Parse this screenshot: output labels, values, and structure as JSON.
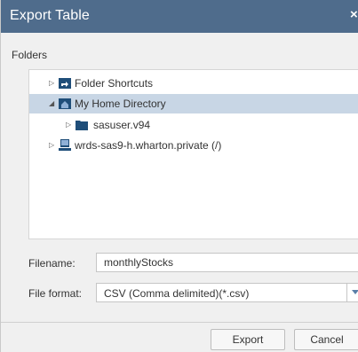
{
  "dialog": {
    "title": "Export Table",
    "close_glyph": "×"
  },
  "folders": {
    "label": "Folders",
    "items": [
      {
        "label": "Folder Shortcuts",
        "icon": "folder-shortcuts-icon",
        "expanded": false,
        "level": 0
      },
      {
        "label": "My Home Directory",
        "icon": "home-folder-icon",
        "expanded": true,
        "level": 0,
        "selected": true
      },
      {
        "label": "sasuser.v94",
        "icon": "folder-icon",
        "expanded": false,
        "level": 1
      },
      {
        "label": "wrds-sas9-h.wharton.private (/)",
        "icon": "server-icon",
        "expanded": false,
        "level": 0
      }
    ]
  },
  "form": {
    "filename_label": "Filename:",
    "filename_value": "monthlyStocks",
    "format_label": "File format:",
    "format_value": "CSV (Comma delimited)(*.csv)"
  },
  "buttons": {
    "export": "Export",
    "cancel": "Cancel"
  },
  "colors": {
    "titlebar": "#4f6c8c",
    "selection": "#c8d6e5",
    "folder_icon": "#1f4e79"
  }
}
